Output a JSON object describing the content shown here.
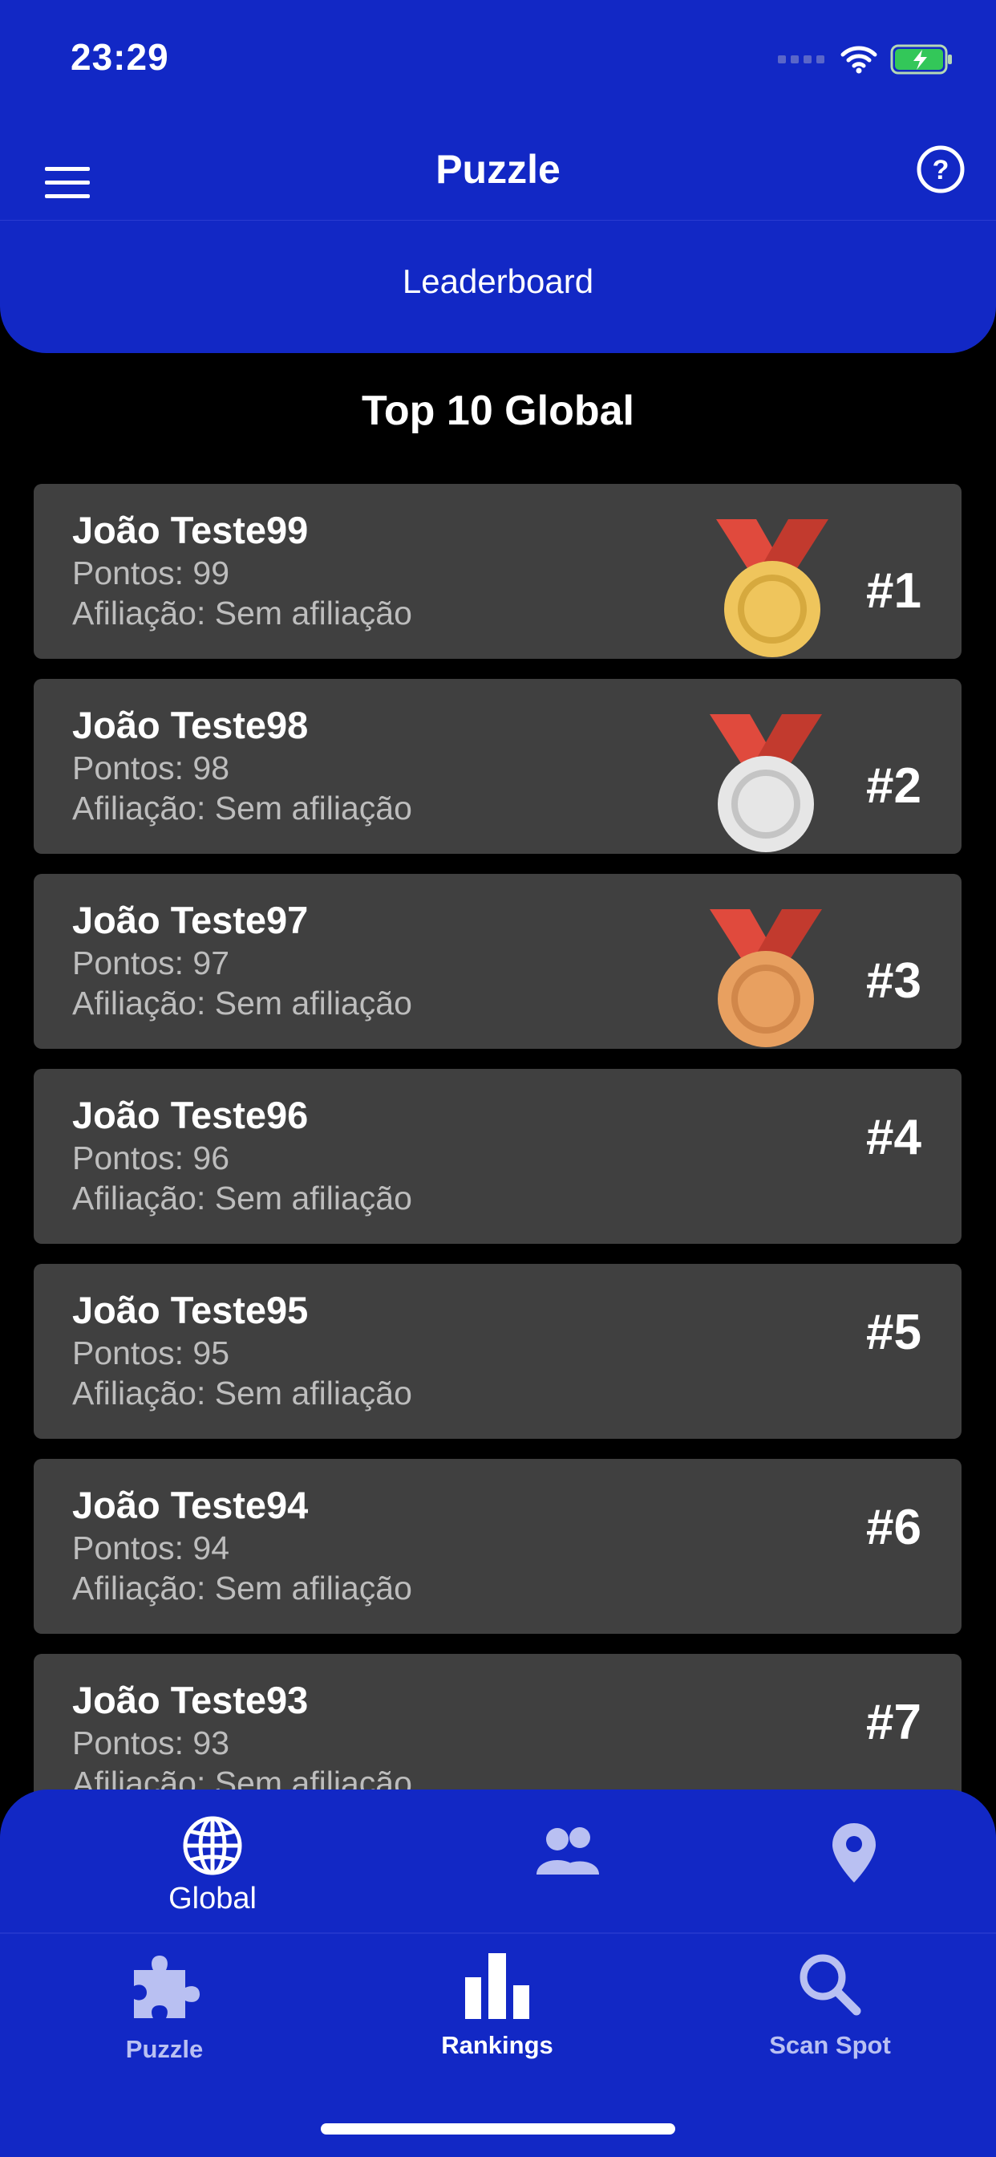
{
  "status_bar": {
    "time": "23:29",
    "icons": [
      "signal-icon",
      "wifi-icon",
      "battery-charging-icon"
    ]
  },
  "header": {
    "title": "Puzzle",
    "menu_icon": "hamburger-icon",
    "help_icon": "help-circle-icon"
  },
  "subheader": {
    "label": "Leaderboard"
  },
  "section": {
    "title": "Top 10 Global"
  },
  "leaderboard": [
    {
      "name": "João Teste99",
      "points": "Pontos: 99",
      "affiliation": "Afiliação: Sem afiliação",
      "rank": "#1",
      "medal": "gold"
    },
    {
      "name": "João Teste98",
      "points": "Pontos: 98",
      "affiliation": "Afiliação: Sem afiliação",
      "rank": "#2",
      "medal": "silver"
    },
    {
      "name": "João Teste97",
      "points": "Pontos: 97",
      "affiliation": "Afiliação: Sem afiliação",
      "rank": "#3",
      "medal": "bronze"
    },
    {
      "name": "João Teste96",
      "points": "Pontos: 96",
      "affiliation": "Afiliação: Sem afiliação",
      "rank": "#4"
    },
    {
      "name": "João Teste95",
      "points": "Pontos: 95",
      "affiliation": "Afiliação: Sem afiliação",
      "rank": "#5"
    },
    {
      "name": "João Teste94",
      "points": "Pontos: 94",
      "affiliation": "Afiliação: Sem afiliação",
      "rank": "#6"
    },
    {
      "name": "João Teste93",
      "points": "Pontos: 93",
      "affiliation": "Afiliação: Sem afiliação",
      "rank": "#7"
    }
  ],
  "ranking_tabs": [
    {
      "label": "Global",
      "icon": "globe-icon",
      "active": true
    },
    {
      "label": "",
      "icon": "people-icon",
      "active": false
    },
    {
      "label": "",
      "icon": "location-pin-icon",
      "active": false
    }
  ],
  "bottom_nav": [
    {
      "label": "Puzzle",
      "icon": "puzzle-icon",
      "active": false
    },
    {
      "label": "Rankings",
      "icon": "bar-chart-icon",
      "active": true
    },
    {
      "label": "Scan Spot",
      "icon": "search-icon",
      "active": false
    }
  ],
  "colors": {
    "primary": "#1228c5",
    "background": "#000000",
    "card": "#404040",
    "muted_text": "#bdbdbd",
    "inactive_nav": "#b9c0f2",
    "gold": "#efc55c",
    "silver": "#d9d9d9",
    "bronze": "#e8a060",
    "ribbon": "#e04a3d"
  }
}
